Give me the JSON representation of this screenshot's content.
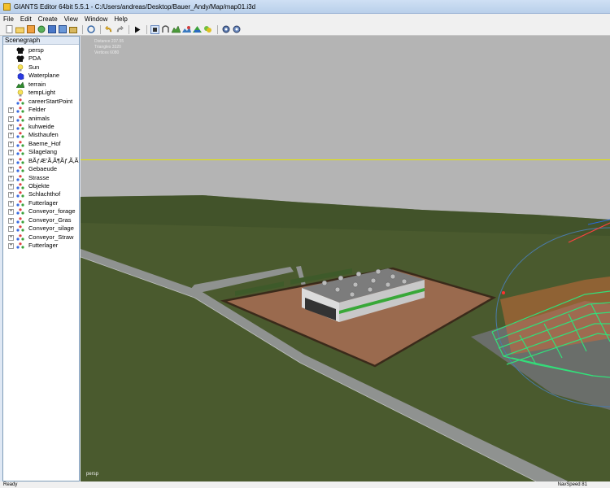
{
  "window": {
    "title": "GIANTS Editor 64bit 5.5.1 - C:/Users/andreas/Desktop/Bauer_Andy/Map/map01.i3d"
  },
  "menu": [
    "File",
    "Edit",
    "Create",
    "View",
    "Window",
    "Help"
  ],
  "toolbar": {
    "buttons": [
      "new-icon",
      "open-icon",
      "save-icon",
      "reload-icon",
      "save-as-icon",
      "export-icon",
      "import-icon",
      "rotate-icon",
      "undo-icon",
      "redo-icon",
      "play-icon",
      "select-icon",
      "magnet-icon",
      "terrain-sculpt-icon",
      "paint-icon",
      "foliage-icon",
      "decals-icon",
      "settings-icon",
      "gizmo-icon"
    ]
  },
  "scenegraph": {
    "title": "Scenegraph",
    "items": [
      {
        "label": "persp",
        "icon": "camera-icon",
        "expandable": false
      },
      {
        "label": "PDA",
        "icon": "camera-icon",
        "expandable": false
      },
      {
        "label": "Sun",
        "icon": "light-icon",
        "expandable": false
      },
      {
        "label": "Waterplane",
        "icon": "shape-icon",
        "expandable": false
      },
      {
        "label": "terrain",
        "icon": "terrain-icon",
        "expandable": false
      },
      {
        "label": "tempLight",
        "icon": "light-icon",
        "expandable": false
      },
      {
        "label": "careerStartPoint",
        "icon": "transform-icon",
        "expandable": false
      },
      {
        "label": "Felder",
        "icon": "transform-icon",
        "expandable": true
      },
      {
        "label": "animals",
        "icon": "transform-icon",
        "expandable": true
      },
      {
        "label": "kuhweide",
        "icon": "transform-icon",
        "expandable": true
      },
      {
        "label": "Misthaufen",
        "icon": "transform-icon",
        "expandable": true
      },
      {
        "label": "Baeme_Hof",
        "icon": "transform-icon",
        "expandable": true
      },
      {
        "label": "Silagelang",
        "icon": "transform-icon",
        "expandable": true
      },
      {
        "label": "BÃƒÆ’Ã‚Ã¶Ãƒ‚Ã‚Ãƒ",
        "icon": "transform-icon",
        "expandable": true
      },
      {
        "label": "Gebaeude",
        "icon": "transform-icon",
        "expandable": true
      },
      {
        "label": "Strasse",
        "icon": "transform-icon",
        "expandable": true
      },
      {
        "label": "Objekte",
        "icon": "transform-icon",
        "expandable": true
      },
      {
        "label": "Schlachthof",
        "icon": "transform-icon",
        "expandable": true
      },
      {
        "label": "Futterlager",
        "icon": "transform-icon",
        "expandable": true
      },
      {
        "label": "Conveyor_forage",
        "icon": "transform-icon",
        "expandable": true
      },
      {
        "label": "Conveyor_Gras",
        "icon": "transform-icon",
        "expandable": true
      },
      {
        "label": "Conveyor_silage",
        "icon": "transform-icon",
        "expandable": true
      },
      {
        "label": "Conveyor_Straw",
        "icon": "transform-icon",
        "expandable": true
      },
      {
        "label": "Futterlager",
        "icon": "transform-icon",
        "expandable": true
      }
    ]
  },
  "viewport": {
    "stats": [
      "Distance  237.55",
      "Triangles  3320",
      "Vertices  6080"
    ],
    "camera_label": "persp"
  },
  "status": {
    "left": "Ready",
    "right": "NavSpeed 81"
  },
  "colors": {
    "sky": "#b4b4b4",
    "grass": "#4a5a2e",
    "road": "#8f9290",
    "gravel": "#9a6a4e",
    "selection": "#32e07a",
    "horizon_line": "#e6e600"
  }
}
